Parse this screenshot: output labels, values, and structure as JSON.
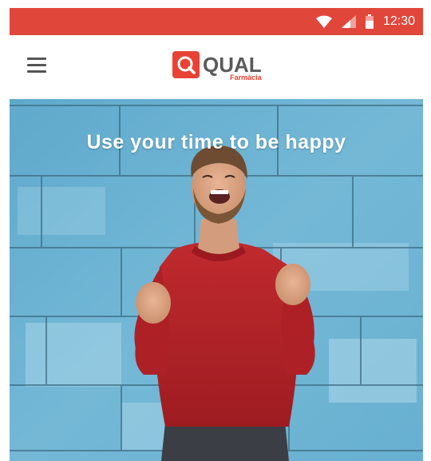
{
  "colors": {
    "status_bar": "#e0463a",
    "brand_red": "#e94235",
    "hero_wall": "#6eb3d2",
    "sweater": "#b21f24"
  },
  "status_bar": {
    "icons": [
      "wifi-icon",
      "cell-signal-icon",
      "battery-icon"
    ],
    "time": "12:30"
  },
  "app_bar": {
    "menu_icon": "hamburger-menu-icon",
    "logo": {
      "icon": "search-q-logo-icon",
      "word": "QUAL",
      "sub": "Farmácia"
    }
  },
  "hero": {
    "title": "Use your time to be happy",
    "image": "smiling-man-red-sweater-photo"
  }
}
